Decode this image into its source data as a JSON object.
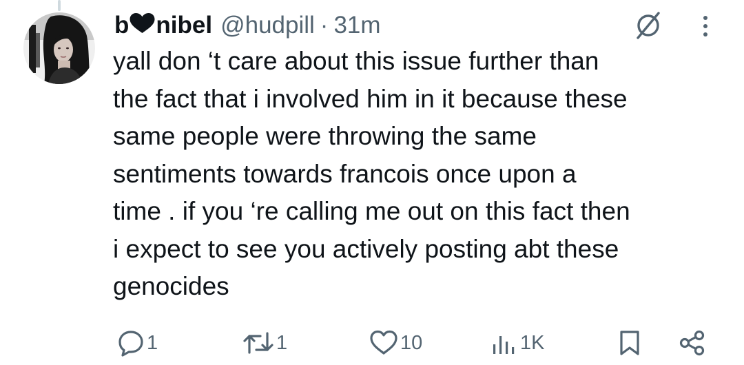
{
  "tweet": {
    "display_name_prefix": "b",
    "display_name_suffix": "nibel",
    "handle": "@hudpill",
    "separator": "·",
    "timestamp": "31m",
    "text": "yall don ‘t care about this issue further than\nthe fact that i involved him in it because these\nsame people were throwing the same\nsentiments towards francois once upon a\ntime . if you ‘re calling me out on this fact then\ni expect to see you actively posting abt these\ngenocides"
  },
  "actions": {
    "replies": "1",
    "reposts": "1",
    "likes": "10",
    "views": "1K"
  },
  "icons": {
    "name_heart": "heart-icon",
    "grok": "grok-icon",
    "more": "more-vertical-icon",
    "reply": "reply-icon",
    "repost": "repost-icon",
    "like": "like-icon",
    "views": "views-icon",
    "bookmark": "bookmark-icon",
    "share": "share-icon"
  },
  "colors": {
    "text_primary": "#0f1419",
    "text_secondary": "#536471",
    "thread_line": "#cfd9de",
    "background": "#ffffff"
  }
}
